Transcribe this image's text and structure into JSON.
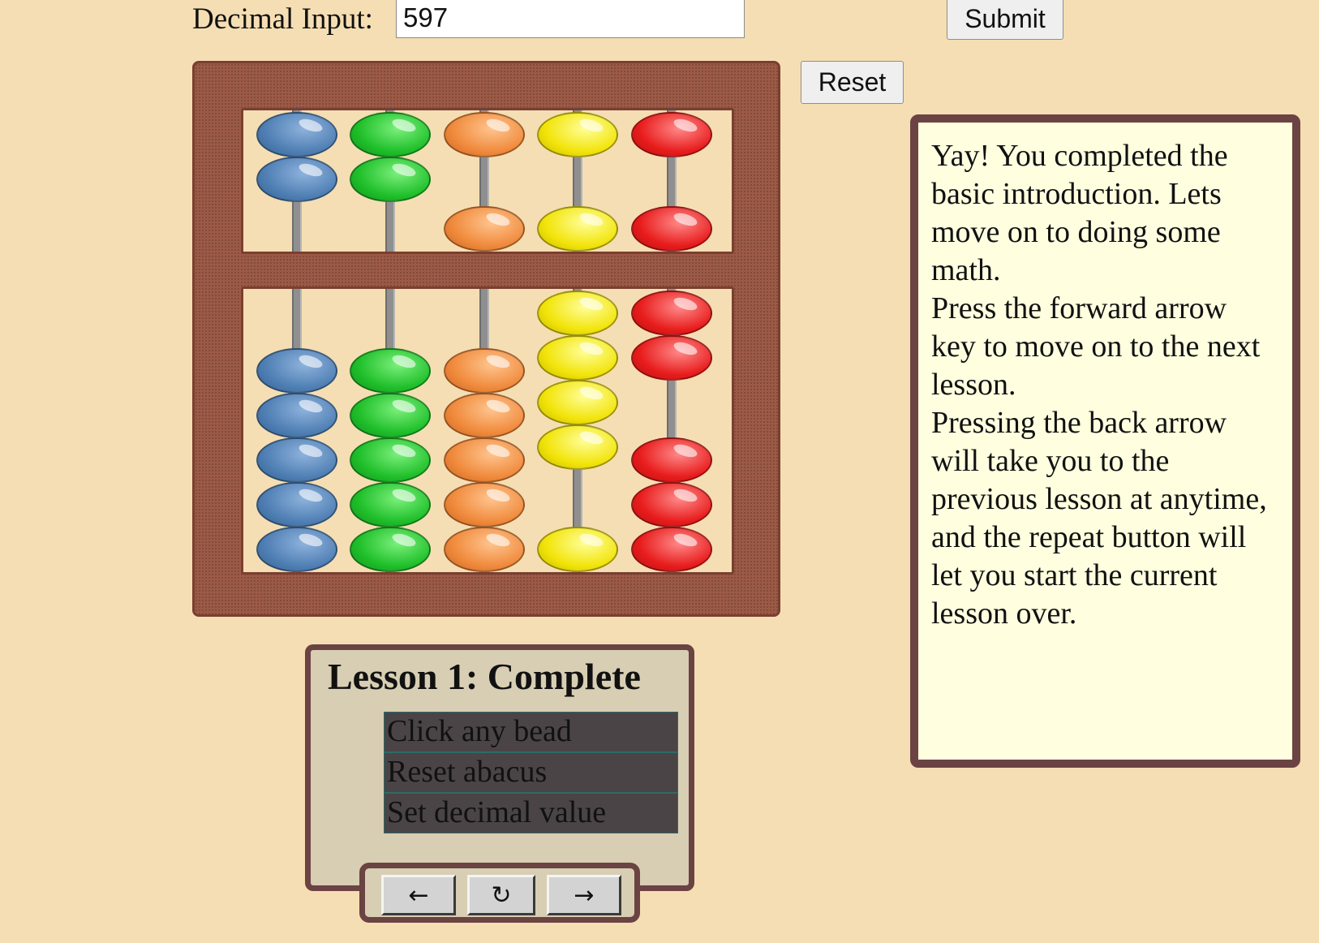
{
  "decimal_input": {
    "label": "Decimal Input:",
    "value": "597",
    "submit_label": "Submit"
  },
  "reset_label": "Reset",
  "abacus": {
    "columns": [
      {
        "color": "blue",
        "hex": "#4f7fb4",
        "upper_active": 0,
        "lower_active": 0
      },
      {
        "color": "green",
        "hex": "#1fbf2a",
        "upper_active": 0,
        "lower_active": 0
      },
      {
        "color": "orange",
        "hex": "#f08a3c",
        "upper_active": 1,
        "lower_active": 0
      },
      {
        "color": "yellow",
        "hex": "#f2e40a",
        "upper_active": 1,
        "lower_active": 4
      },
      {
        "color": "red",
        "hex": "#e81c1c",
        "upper_active": 1,
        "lower_active": 2
      }
    ]
  },
  "lesson": {
    "title": "Lesson 1: Complete",
    "steps": [
      "Click any bead",
      "Reset abacus",
      "Set decimal value"
    ]
  },
  "nav": {
    "back": "←",
    "repeat": "↻",
    "forward": "→"
  },
  "info": {
    "paragraphs": [
      "Yay! You completed the basic introduction. Lets move on to doing some math.",
      "Press the forward arrow key to move on to the next lesson.",
      "Pressing the back arrow will take you to the previous lesson at anytime, and the repeat button will let you start the current lesson over."
    ]
  },
  "colors": {
    "background": "#f5deb3",
    "frame": "#9c5a46",
    "panel_border": "#6b4343",
    "step_bg": "#4a4446",
    "info_bg": "#ffffe0"
  }
}
